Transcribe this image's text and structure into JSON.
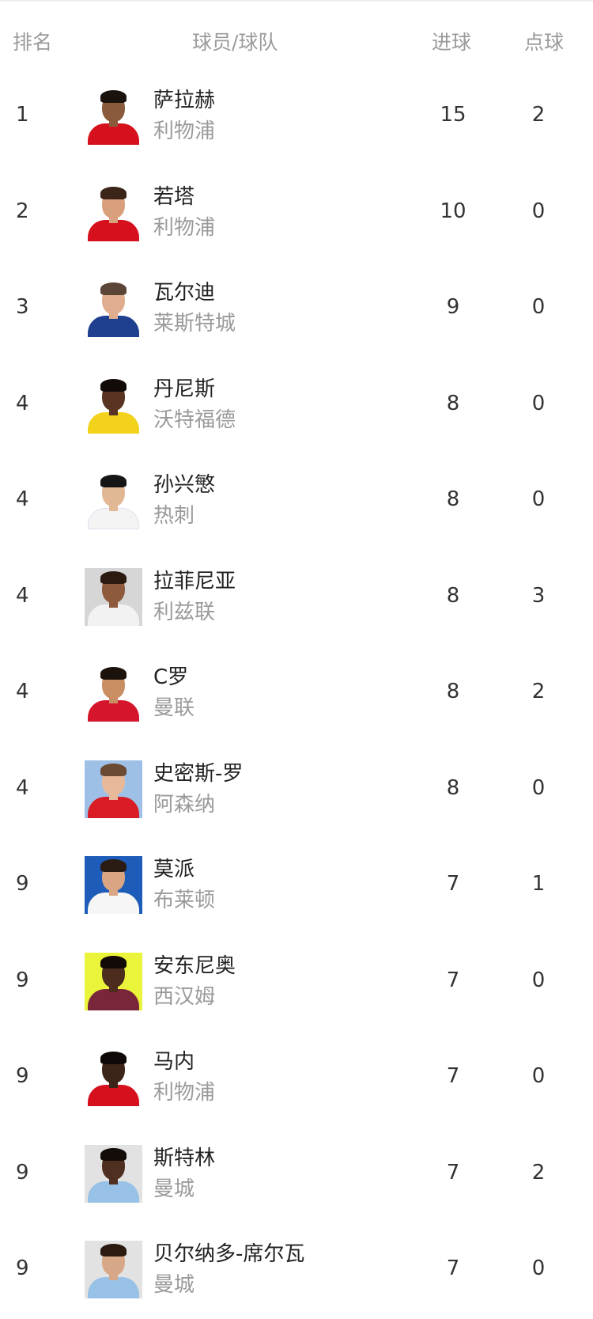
{
  "header": {
    "rank": "排名",
    "player_team": "球员/球队",
    "goals": "进球",
    "penalties": "点球"
  },
  "rows": [
    {
      "rank": "1",
      "name": "萨拉赫",
      "team": "利物浦",
      "goals": "15",
      "penalties": "2"
    },
    {
      "rank": "2",
      "name": "若塔",
      "team": "利物浦",
      "goals": "10",
      "penalties": "0"
    },
    {
      "rank": "3",
      "name": "瓦尔迪",
      "team": "莱斯特城",
      "goals": "9",
      "penalties": "0"
    },
    {
      "rank": "4",
      "name": "丹尼斯",
      "team": "沃特福德",
      "goals": "8",
      "penalties": "0"
    },
    {
      "rank": "4",
      "name": "孙兴慜",
      "team": "热刺",
      "goals": "8",
      "penalties": "0"
    },
    {
      "rank": "4",
      "name": "拉菲尼亚",
      "team": "利兹联",
      "goals": "8",
      "penalties": "3"
    },
    {
      "rank": "4",
      "name": "C罗",
      "team": "曼联",
      "goals": "8",
      "penalties": "2"
    },
    {
      "rank": "4",
      "name": "史密斯-罗",
      "team": "阿森纳",
      "goals": "8",
      "penalties": "0"
    },
    {
      "rank": "9",
      "name": "莫派",
      "team": "布莱顿",
      "goals": "7",
      "penalties": "1"
    },
    {
      "rank": "9",
      "name": "安东尼奥",
      "team": "西汉姆",
      "goals": "7",
      "penalties": "0"
    },
    {
      "rank": "9",
      "name": "马内",
      "team": "利物浦",
      "goals": "7",
      "penalties": "0"
    },
    {
      "rank": "9",
      "name": "斯特林",
      "team": "曼城",
      "goals": "7",
      "penalties": "2"
    },
    {
      "rank": "9",
      "name": "贝尔纳多-席尔瓦",
      "team": "曼城",
      "goals": "7",
      "penalties": "0"
    }
  ],
  "colors": {
    "text_primary": "#222222",
    "text_secondary": "#9a9a9a",
    "liverpool_red": "#d6101c",
    "leicester_blue": "#1f3f8f",
    "watford_yellow": "#f2d21b",
    "spurs_white": "#f4f4f4",
    "leeds_white": "#f2f2f2",
    "manutd_red": "#d4152b",
    "arsenal_red": "#d81b24",
    "brighton_white": "#f6f6f6",
    "westham_claret": "#7a263a",
    "mancity_blue": "#97c1e7"
  }
}
